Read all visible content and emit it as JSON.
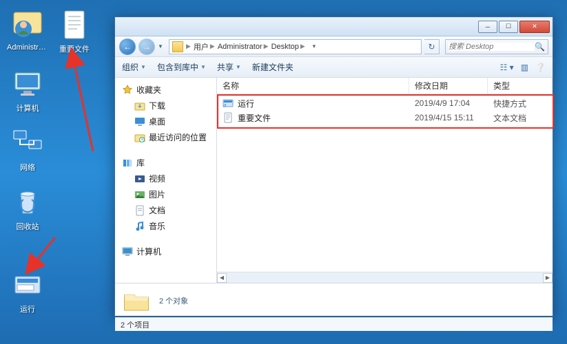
{
  "desktop": {
    "icons": [
      {
        "label": "Administra...",
        "kind": "admin"
      },
      {
        "label": "重要文件",
        "kind": "txt"
      },
      {
        "label": "计算机",
        "kind": "pc"
      },
      {
        "label": "网络",
        "kind": "net"
      },
      {
        "label": "回收站",
        "kind": "bin"
      },
      {
        "label": "运行",
        "kind": "run"
      }
    ]
  },
  "breadcrumb": {
    "parts": [
      "用户",
      "Administrator",
      "Desktop"
    ]
  },
  "search": {
    "placeholder": "搜索 Desktop"
  },
  "toolbar": {
    "org": "组织",
    "include": "包含到库中",
    "share": "共享",
    "newf": "新建文件夹"
  },
  "nav": {
    "fav": "收藏夹",
    "dl": "下载",
    "dk": "桌面",
    "rc": "最近访问的位置",
    "lib": "库",
    "vid": "视频",
    "pic": "图片",
    "doc": "文档",
    "mus": "音乐",
    "comp": "计算机"
  },
  "columns": {
    "name": "名称",
    "date": "修改日期",
    "type": "类型"
  },
  "files": [
    {
      "name": "运行",
      "date": "2019/4/9 17:04",
      "type": "快捷方式",
      "kind": "run"
    },
    {
      "name": "重要文件",
      "date": "2019/4/15 15:11",
      "type": "文本文档",
      "kind": "txt"
    }
  ],
  "details": {
    "count": "2 个对象"
  },
  "status": {
    "text": "2 个项目"
  }
}
